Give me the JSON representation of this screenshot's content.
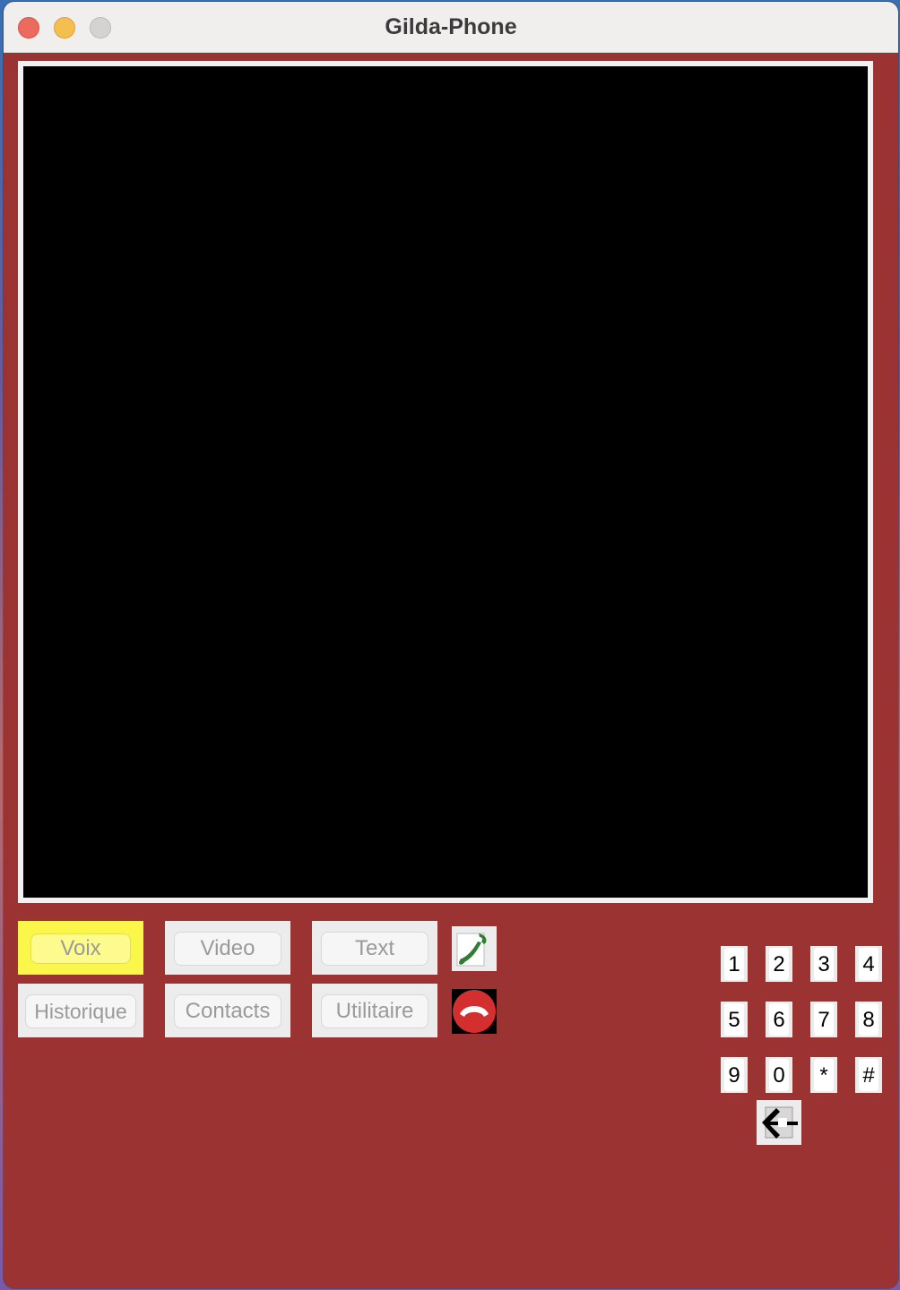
{
  "window": {
    "title": "Gilda-Phone"
  },
  "modes": {
    "voice": "Voix",
    "video": "Video",
    "text": "Text",
    "history": "Historique",
    "contacts": "Contacts",
    "utility": "Utilitaire",
    "active": "Voix"
  },
  "call_controls": {
    "accept_icon": "phone-accept-icon",
    "hangup_icon": "phone-hangup-icon",
    "accept_color": "#2e7d32",
    "hangup_color": "#d32f2f"
  },
  "keypad": {
    "keys": [
      "1",
      "2",
      "3",
      "4",
      "5",
      "6",
      "7",
      "8",
      "9",
      "0",
      "*",
      "#"
    ],
    "backspace_icon": "backspace-arrow-icon"
  },
  "colors": {
    "window_bg": "#9a3331",
    "active_tab": "#fbf64a",
    "video_bg": "#000000"
  }
}
